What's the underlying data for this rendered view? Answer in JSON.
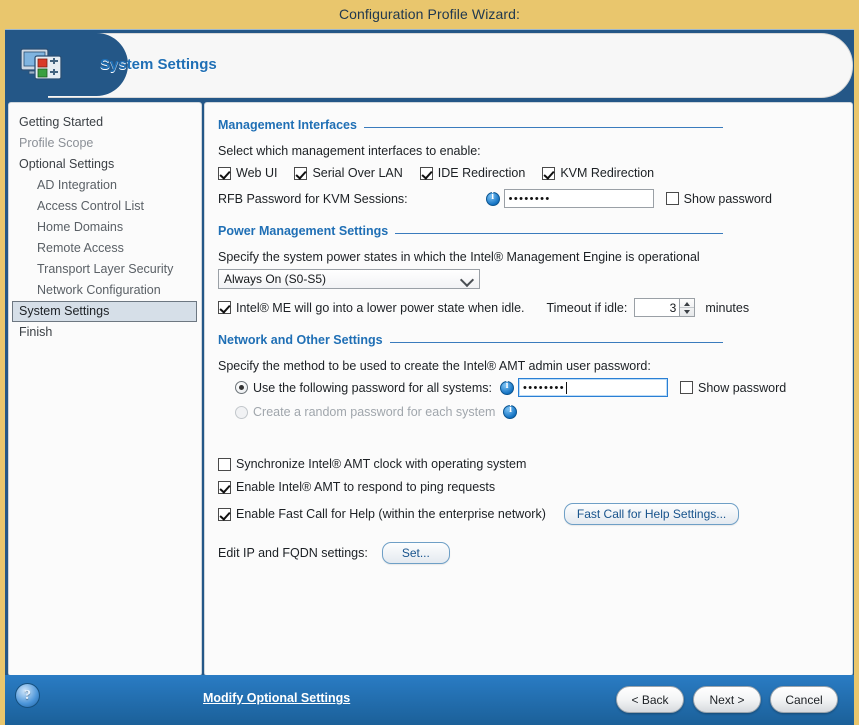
{
  "window": {
    "title": "Configuration Profile Wizard:"
  },
  "header": {
    "title": "System Settings",
    "icon": "system-settings-monitor-icon"
  },
  "sidebar": {
    "items": [
      {
        "label": "Getting Started",
        "level": 0,
        "state": "normal"
      },
      {
        "label": "Profile Scope",
        "level": 0,
        "state": "dim"
      },
      {
        "label": "Optional Settings",
        "level": 0,
        "state": "normal"
      },
      {
        "label": "AD Integration",
        "level": 1,
        "state": "normal"
      },
      {
        "label": "Access Control List",
        "level": 1,
        "state": "normal"
      },
      {
        "label": "Home Domains",
        "level": 1,
        "state": "normal"
      },
      {
        "label": "Remote Access",
        "level": 1,
        "state": "normal"
      },
      {
        "label": "Transport Layer Security",
        "level": 1,
        "state": "normal"
      },
      {
        "label": "Network Configuration",
        "level": 1,
        "state": "normal"
      },
      {
        "label": "System Settings",
        "level": 0,
        "state": "selected"
      },
      {
        "label": "Finish",
        "level": 0,
        "state": "normal"
      }
    ]
  },
  "management_interfaces": {
    "legend": "Management Interfaces",
    "description": "Select which management interfaces to enable:",
    "checkboxes": [
      {
        "label": "Web UI",
        "checked": true
      },
      {
        "label": "Serial Over LAN",
        "checked": true
      },
      {
        "label": "IDE Redirection",
        "checked": true
      },
      {
        "label": "KVM Redirection",
        "checked": true
      }
    ],
    "rfb_label": "RFB Password for KVM Sessions:",
    "rfb_value": "••••••••",
    "show_password_label": "Show password",
    "show_password_checked": false
  },
  "power_management": {
    "legend": "Power Management Settings",
    "description": "Specify the system power states in which the Intel® Management Engine is operational",
    "power_state_value": "Always On (S0-S5)",
    "power_state_options": [
      "Always On (S0-S5)"
    ],
    "idle_checkbox_label": "Intel® ME will go into a lower power state when idle.",
    "idle_checkbox_checked": true,
    "timeout_label": "Timeout if idle:",
    "timeout_value": "3",
    "timeout_units": "minutes"
  },
  "network_other": {
    "legend": "Network and Other Settings",
    "description": "Specify the method to be used to create the Intel® AMT admin user password:",
    "radio_same_label": "Use the following password for all systems:",
    "radio_same_selected": true,
    "admin_password_value": "••••••••",
    "show_password_label": "Show password",
    "show_password_checked": false,
    "radio_random_label": "Create a random password for each system",
    "radio_random_selected": false,
    "radio_random_disabled": true,
    "options": [
      {
        "label": "Synchronize Intel® AMT clock with operating system",
        "checked": false
      },
      {
        "label": "Enable Intel® AMT to respond to ping requests",
        "checked": true
      },
      {
        "label": "Enable Fast Call for Help (within the enterprise network)",
        "checked": true
      }
    ],
    "fast_call_button": "Fast Call for Help Settings...",
    "edit_ip_label": "Edit IP and FQDN settings:",
    "set_button": "Set..."
  },
  "footer": {
    "help_icon": "help-question-icon",
    "modify_link": "Modify Optional Settings",
    "back_button": "< Back",
    "next_button": "Next >",
    "cancel_button": "Cancel"
  },
  "colors": {
    "title_bar": "#e9c66d",
    "frame_blue": "#245787",
    "accent_blue": "#1f6fb5",
    "footer_blue": "#1f6cb0",
    "panel_bg": "#fbfbfb"
  }
}
